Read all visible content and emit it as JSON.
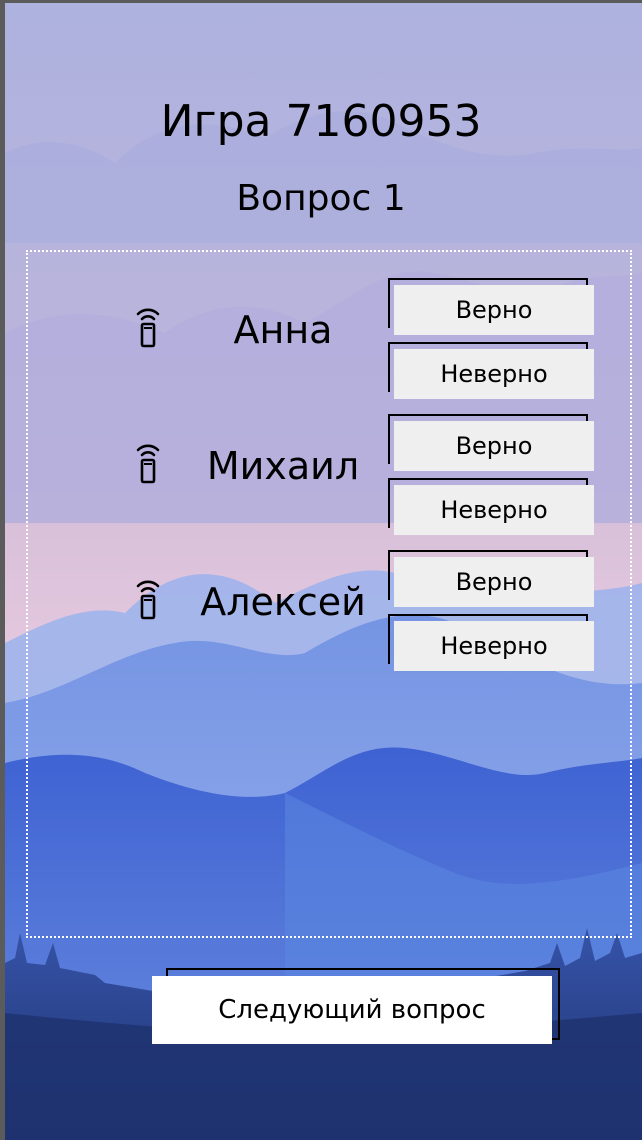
{
  "header": {
    "game_title": "Игра 7160953",
    "question_title": "Вопрос 1"
  },
  "players": [
    {
      "name": "Анна",
      "icon": "signal-phone-icon",
      "correct_label": "Верно",
      "incorrect_label": "Неверно"
    },
    {
      "name": "Михаил",
      "icon": "signal-phone-icon",
      "correct_label": "Верно",
      "incorrect_label": "Неверно"
    },
    {
      "name": "Алексей",
      "icon": "signal-phone-icon",
      "correct_label": "Верно",
      "incorrect_label": "Неверно"
    }
  ],
  "footer": {
    "next_label": "Следующий вопрос"
  },
  "colors": {
    "sky_top": "#aeb2e0",
    "sky_pink": "#e2c6dc",
    "mountain_light": "#8ea6ea",
    "mountain_mid": "#5f86e0",
    "mountain_dark": "#3a5fd0",
    "forest": "#2a3f80",
    "button_bg": "#efefef",
    "next_button_bg": "#ffffff"
  }
}
